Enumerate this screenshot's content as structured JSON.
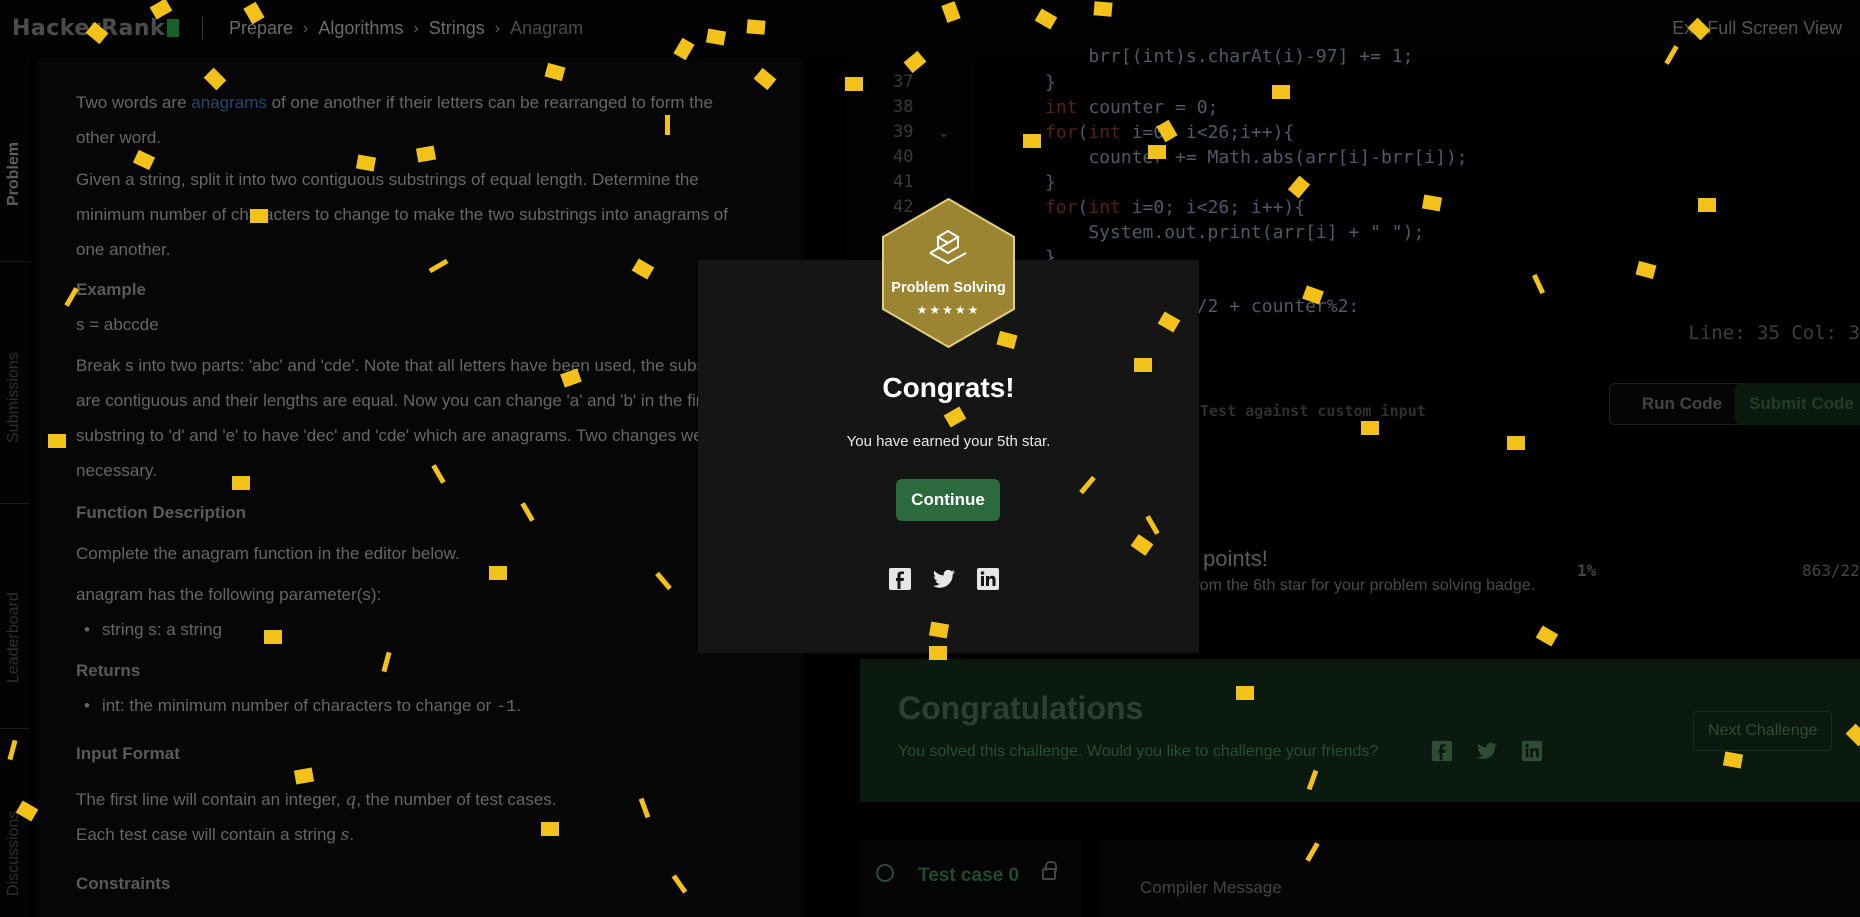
{
  "topbar": {
    "logo": "HackerRank",
    "breadcrumbs": [
      "Prepare",
      "Algorithms",
      "Strings",
      "Anagram"
    ],
    "fullscreen_label": "Exit Full Screen View"
  },
  "side_tabs": [
    "Problem",
    "Submissions",
    "Leaderboard",
    "Discussions"
  ],
  "problem": {
    "intro_pre": "Two words are ",
    "intro_link": "anagrams",
    "intro_post_1": " of one another if their letters can be rearranged to form the",
    "intro_post_2": "other word.",
    "given_1": "Given a string, split it into two contiguous substrings of equal length. Determine the",
    "given_2": "minimum number of characters to change to make the two substrings into anagrams of",
    "given_3": "one another.",
    "example_heading": "Example",
    "example_value": "s = abccde",
    "break_1": "Break s into two parts: 'abc' and 'cde'. Note that all letters have been used, the substrings",
    "break_2": "are contiguous and their lengths are equal. Now you can change 'a' and 'b' in the first",
    "break_3": "substring to 'd' and 'e' to have 'dec' and 'cde' which are anagrams. Two changes were",
    "break_4": "necessary.",
    "function_heading": "Function Description",
    "function_text": "Complete the anagram function in the editor below.",
    "params_text": "anagram has the following parameter(s):",
    "param_1": "string s: a string",
    "returns_heading": "Returns",
    "returns_pre": "int: the minimum number of characters to change or ",
    "returns_code": "-1",
    "returns_post": ".",
    "input_heading": "Input Format",
    "input_1_pre": "The first line will contain an integer, ",
    "input_1_var": "q",
    "input_1_post": ", the number of test cases.",
    "input_2_pre": "Each test case will contain a string ",
    "input_2_var": "s",
    "input_2_post": ".",
    "constraints_heading": "Constraints"
  },
  "editor": {
    "line_numbers": [
      "37",
      "38",
      "39",
      "40",
      "41",
      "42"
    ],
    "code_lines": [
      "    brr[(int)s.charAt(i)-97] += 1;",
      "}",
      "int counter = 0;",
      "for(int i=0; i<26;i++){",
      "    counter += Math.abs(arr[i]-brr[i]);",
      "}",
      "for(int i=0; i<26; i++){",
      "    System.out.print(arr[i] + \" \");",
      "}",
      "return counter/2 + counter%2:"
    ],
    "linecol": "Line: 35 Col: 3",
    "run_label": "Run Code",
    "submit_label": "Submit Code",
    "custom_input": "Test against custom input"
  },
  "result": {
    "points_title": "points!",
    "points_sub": "from the 6th star for your problem solving badge.",
    "percent": "1%",
    "rank": "863/22"
  },
  "success": {
    "title": "Congratulations",
    "subtitle": "You solved this challenge. Would you like to challenge your friends?",
    "next": "Next Challenge"
  },
  "testcase": {
    "label": "Test case 0",
    "compiler": "Compiler Message"
  },
  "modal": {
    "badge_title": "Problem Solving",
    "stars": "★★★★★",
    "congrats": "Congrats!",
    "earned": "You have earned your 5th star.",
    "continue": "Continue"
  },
  "colors": {
    "accent_green": "#2b6a3c",
    "badge_gold": "#9b8432",
    "confetti": "#f2c21a"
  },
  "icons": [
    "facebook-icon",
    "twitter-icon",
    "linkedin-icon",
    "lock-icon",
    "check-circle-icon",
    "chevron-right-icon",
    "fold-chevron-icon"
  ]
}
